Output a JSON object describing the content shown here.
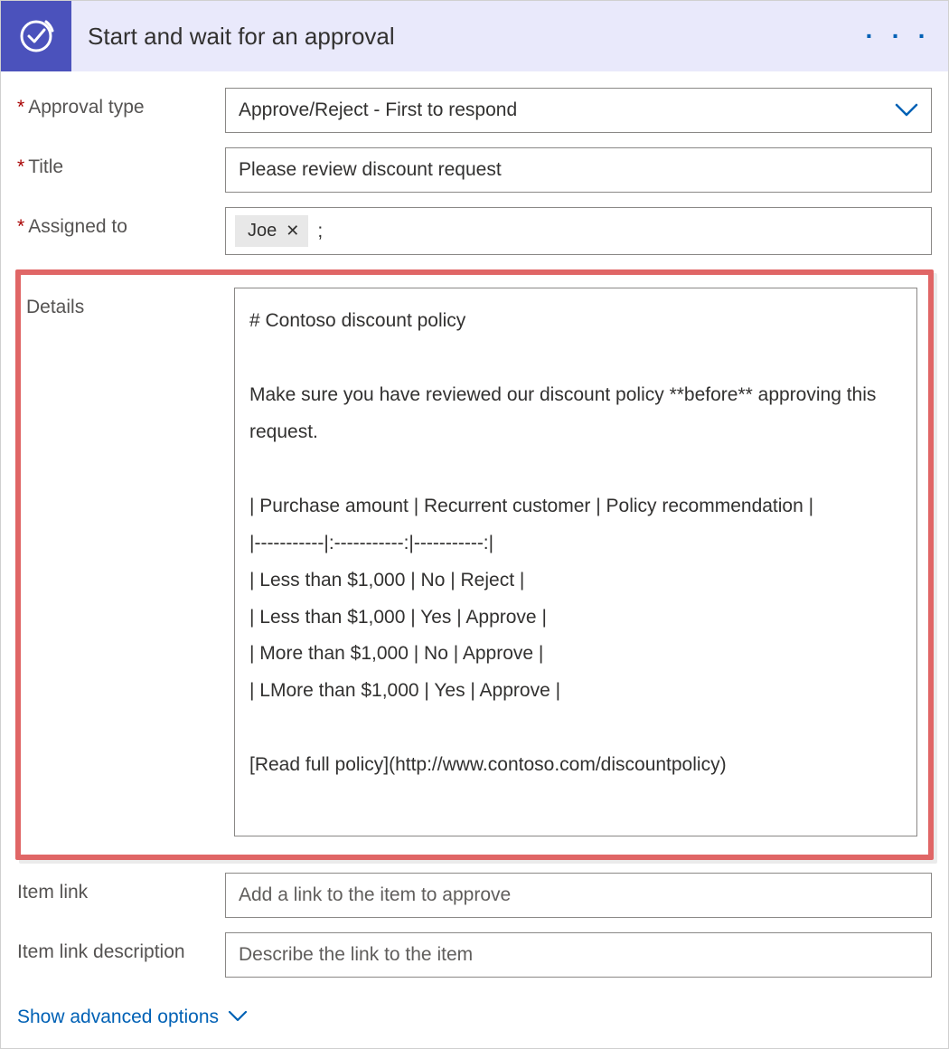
{
  "header": {
    "title": "Start and wait for an approval"
  },
  "fields": {
    "approval_type": {
      "label": "Approval type",
      "value": "Approve/Reject - First to respond"
    },
    "title": {
      "label": "Title",
      "value": "Please review discount request"
    },
    "assigned_to": {
      "label": "Assigned to",
      "token": "Joe",
      "separator": ";"
    },
    "details": {
      "label": "Details",
      "value": "# Contoso discount policy\n\nMake sure you have reviewed our discount policy **before** approving this request.\n\n| Purchase amount | Recurrent customer | Policy recommendation |\n|-----------|:-----------:|-----------:|\n| Less than $1,000 | No | Reject |\n| Less than $1,000 | Yes | Approve |\n| More than $1,000 | No | Approve |\n| LMore than $1,000 | Yes | Approve |\n\n[Read full policy](http://www.contoso.com/discountpolicy)"
    },
    "item_link": {
      "label": "Item link",
      "placeholder": "Add a link to the item to approve"
    },
    "item_link_desc": {
      "label": "Item link description",
      "placeholder": "Describe the link to the item"
    }
  },
  "footer": {
    "show_advanced": "Show advanced options"
  }
}
